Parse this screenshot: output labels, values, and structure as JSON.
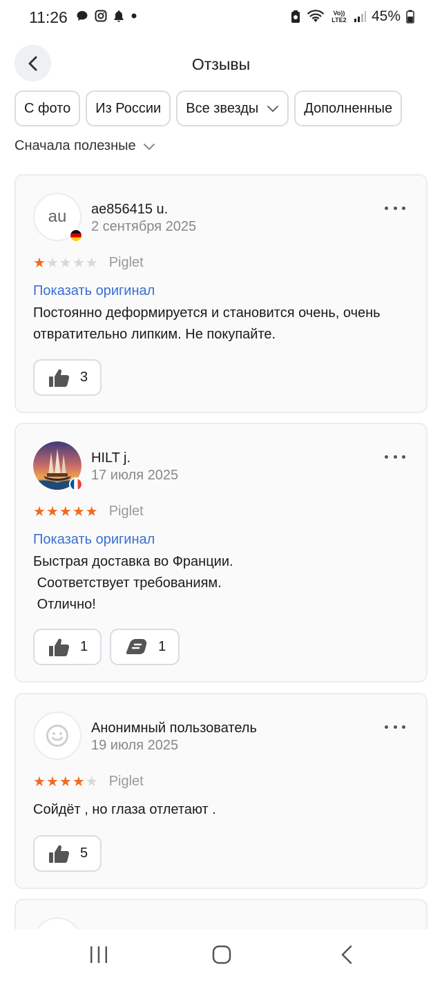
{
  "status": {
    "time": "11:26",
    "battery": "45%",
    "network_label": "Vo)) LTE2"
  },
  "header": {
    "title": "Отзывы",
    "back_icon": "chevron-left-icon"
  },
  "filters": [
    {
      "label": "С фото"
    },
    {
      "label": "Из России"
    },
    {
      "label": "Все звезды",
      "has_dropdown": true
    },
    {
      "label": "Дополненные"
    }
  ],
  "sort": {
    "label": "Сначала полезные"
  },
  "reviews": [
    {
      "avatar_text": "au",
      "flag": "de",
      "name": "ae856415 u.",
      "date": "2 сентября 2025",
      "rating": 1,
      "variant": "Piglet",
      "show_original": "Показать оригинал",
      "text": "Постоянно деформируется и становится очень, очень отвратительно липким. Не покупайте.",
      "likes": "3"
    },
    {
      "avatar_image": "sailing-ship-photo",
      "flag": "fr",
      "name": "HILT j.",
      "date": "17 июля 2025",
      "rating": 5,
      "variant": "Piglet",
      "show_original": "Показать оригинал",
      "text": "Быстрая доставка во Франции.\n Соответствует требованиям.\n Отлично!",
      "likes": "1",
      "comments": "1"
    },
    {
      "avatar_icon": "smiley-icon",
      "name": "Анонимный пользователь",
      "date": "19 июля 2025",
      "rating": 4,
      "variant": "Piglet",
      "text": "Сойдёт , но глаза отлетают .",
      "likes": "5"
    }
  ],
  "colors": {
    "star_active": "#f26b1d",
    "link": "#3a6fcf",
    "card_bg": "#fafafb"
  }
}
